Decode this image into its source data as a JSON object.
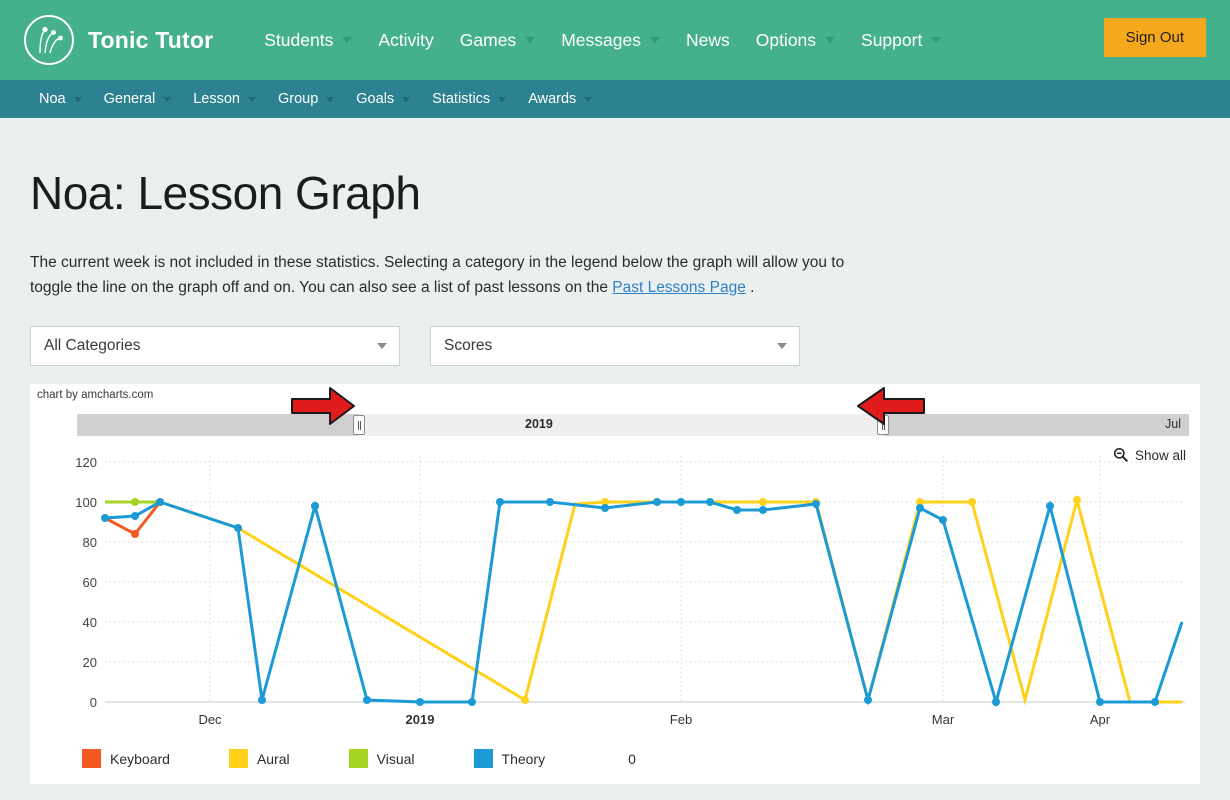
{
  "header": {
    "brand": "Tonic Tutor",
    "logo_icon": "tonic-tutor-logo",
    "nav": [
      {
        "label": "Students",
        "has_caret": true
      },
      {
        "label": "Activity",
        "has_caret": false
      },
      {
        "label": "Games",
        "has_caret": true
      },
      {
        "label": "Messages",
        "has_caret": true
      },
      {
        "label": "News",
        "has_caret": false
      },
      {
        "label": "Options",
        "has_caret": true
      },
      {
        "label": "Support",
        "has_caret": true
      }
    ],
    "signout_label": "Sign Out",
    "brand_color": "#45b08c",
    "signout_color": "#f5a81c"
  },
  "subnav": {
    "background": "#2d8291",
    "items": [
      {
        "label": "Noa",
        "has_caret": true
      },
      {
        "label": "General",
        "has_caret": true
      },
      {
        "label": "Lesson",
        "has_caret": true
      },
      {
        "label": "Group",
        "has_caret": true
      },
      {
        "label": "Goals",
        "has_caret": true
      },
      {
        "label": "Statistics",
        "has_caret": true
      },
      {
        "label": "Awards",
        "has_caret": true
      }
    ]
  },
  "page": {
    "title": "Noa: Lesson Graph",
    "intro_part1": "The current week is not included in these statistics. Selecting a category in the legend below the graph will allow you to toggle the line on the graph off and on. You can also see a list of past lessons on the ",
    "intro_link": "Past Lessons Page",
    "intro_part2": " ."
  },
  "filters": {
    "category_value": "All Categories",
    "metric_value": "Scores"
  },
  "chart_panel": {
    "credit": "chart by amcharts.com",
    "scroll_center_label": "2019",
    "scroll_right_label": "Jul",
    "show_all_label": "Show all",
    "show_all_icon": "zoom-out-icon",
    "grip_left_icon": "scrollbar-grip-left",
    "grip_right_icon": "scrollbar-grip-right",
    "arrow_left_icon": "red-arrow-right-pointing",
    "arrow_right_icon": "red-arrow-left-pointing"
  },
  "chart_data": {
    "type": "line",
    "title": "Noa: Lesson Graph",
    "xlabel": "",
    "ylabel": "",
    "ylim": [
      0,
      120
    ],
    "yticks": [
      0,
      20,
      40,
      60,
      80,
      100,
      120
    ],
    "xticks": [
      "Dec",
      "2019",
      "Feb",
      "Mar",
      "Apr"
    ],
    "grid": true,
    "legend_position": "bottom",
    "legend_extra_value": "0",
    "x": [
      "2018-11-11",
      "2018-11-18",
      "2018-11-25",
      "2018-12-09",
      "2018-12-16",
      "2018-12-30",
      "2019-01-06",
      "2019-01-13",
      "2019-01-20",
      "2019-01-27",
      "2019-02-03",
      "2019-02-10",
      "2019-02-17",
      "2019-02-24",
      "2019-03-03",
      "2019-03-10",
      "2019-03-17",
      "2019-03-24",
      "2019-03-31",
      "2019-04-07",
      "2019-04-14",
      "2019-04-21",
      "2019-04-28"
    ],
    "series": [
      {
        "name": "Keyboard",
        "color": "#f15a22",
        "values": [
          92,
          84,
          100,
          null,
          null,
          null,
          null,
          null,
          null,
          null,
          null,
          null,
          null,
          null,
          null,
          null,
          null,
          null,
          null,
          null,
          null,
          null,
          null
        ]
      },
      {
        "name": "Aural",
        "color": "#ffd11a",
        "values": [
          null,
          null,
          null,
          87,
          null,
          null,
          null,
          1,
          95,
          101,
          101,
          101,
          101,
          101,
          null,
          101,
          101,
          null,
          null,
          101,
          null,
          0,
          null
        ]
      },
      {
        "name": "Visual",
        "color": "#a4d321",
        "values": [
          100,
          100,
          100,
          null,
          null,
          null,
          null,
          null,
          null,
          null,
          null,
          null,
          null,
          null,
          null,
          null,
          null,
          null,
          null,
          null,
          null,
          null,
          null
        ]
      },
      {
        "name": "Theory",
        "color": "#1b9ad6",
        "values": [
          90,
          90,
          100,
          87,
          0,
          95,
          0,
          0,
          100,
          100,
          100,
          100,
          95,
          95,
          0,
          100,
          89,
          0,
          0,
          88,
          0,
          0,
          48
        ]
      }
    ]
  },
  "legend": [
    {
      "label": "Keyboard",
      "color": "#f15a22"
    },
    {
      "label": "Aural",
      "color": "#ffd11a"
    },
    {
      "label": "Visual",
      "color": "#a4d321"
    },
    {
      "label": "Theory",
      "color": "#1b9ad6"
    }
  ]
}
